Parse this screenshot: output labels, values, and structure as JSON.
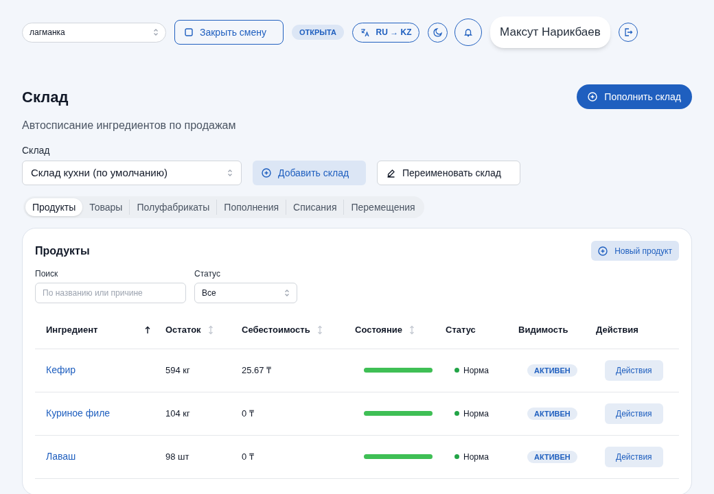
{
  "topbar": {
    "location_select": "лагманка",
    "close_shift_button": "Закрыть смену",
    "shift_status": "ОТКРЫТА",
    "language_button": "RU → KZ",
    "user_name": "Максут Нарикбаев"
  },
  "page": {
    "title": "Склад",
    "subtitle": "Автосписание ингредиентов по продажам",
    "replenish_button": "Пополнить склад"
  },
  "warehouse": {
    "label": "Склад",
    "value": "Склад кухни (по умолчанию)",
    "add_button": "Добавить склад",
    "rename_button": "Переименовать склад"
  },
  "tabs": [
    {
      "label": "Продукты",
      "selected": true
    },
    {
      "label": "Товары",
      "selected": false
    },
    {
      "label": "Полуфабрикаты",
      "selected": false
    },
    {
      "label": "Пополнения",
      "selected": false
    },
    {
      "label": "Списания",
      "selected": false
    },
    {
      "label": "Перемещения",
      "selected": false
    }
  ],
  "card": {
    "title": "Продукты",
    "new_button": "Новый продукт",
    "search_label": "Поиск",
    "search_placeholder": "По названию или причине",
    "status_label": "Статус",
    "status_value": "Все"
  },
  "table": {
    "columns": [
      {
        "label": "Ингредиент",
        "sortable": true,
        "sorted": true
      },
      {
        "label": "Остаток",
        "sortable": true,
        "sorted": false
      },
      {
        "label": "Себестоимость",
        "sortable": true,
        "sorted": false
      },
      {
        "label": "Состояние",
        "sortable": true,
        "sorted": false
      },
      {
        "label": "Статус",
        "sortable": false
      },
      {
        "label": "Видимость",
        "sortable": false
      },
      {
        "label": "Действия",
        "sortable": false
      }
    ],
    "rows": [
      {
        "ingredient": "Кефир",
        "stock": "594 кг",
        "cost": "25.67 ₸",
        "level": 1,
        "status": "Норма",
        "color": "#22a447",
        "visibility": "АКТИВЕН",
        "action": "Действия"
      },
      {
        "ingredient": "Куриное филе",
        "stock": "104 кг",
        "cost": "0 ₸",
        "level": 1,
        "status": "Норма",
        "color": "#22a447",
        "visibility": "АКТИВЕН",
        "action": "Действия"
      },
      {
        "ingredient": "Лаваш",
        "stock": "98 шт",
        "cost": "0 ₸",
        "level": 1,
        "status": "Норма",
        "color": "#22a447",
        "visibility": "АКТИВЕН",
        "action": "Действия"
      }
    ]
  }
}
